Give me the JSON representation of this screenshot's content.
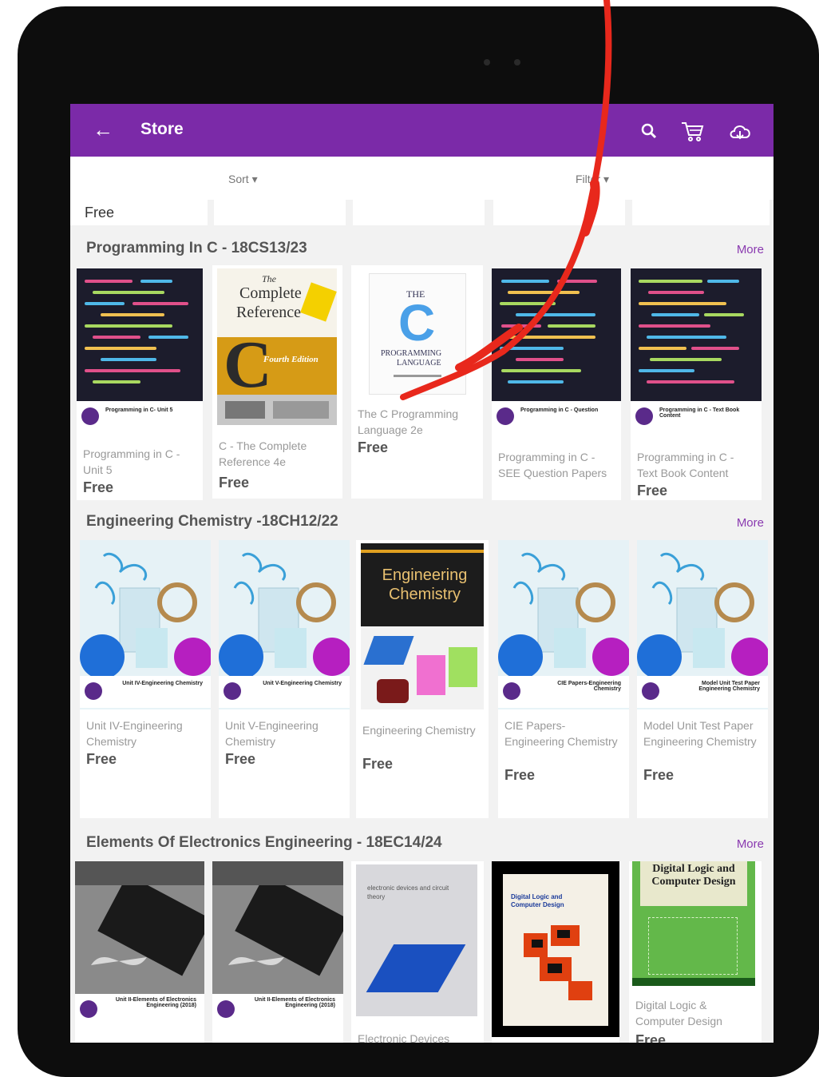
{
  "appbar": {
    "title": "Store"
  },
  "sortbar": {
    "sort_label": "Sort ▾",
    "filter_label": "Filter ▾"
  },
  "prev_row": {
    "price": "Free"
  },
  "sections": [
    {
      "title": "Programming In C - 18CS13/23",
      "more": "More",
      "cards": [
        {
          "title": "Programming in C - Unit 5",
          "price": "Free",
          "cover_type": "code"
        },
        {
          "title": "C - The Complete Reference 4e",
          "price": "Free",
          "cover_type": "c-ref"
        },
        {
          "title": "The C Programming Language 2e",
          "price": "Free",
          "cover_type": "kr"
        },
        {
          "title": "Programming in C - SEE Question Papers",
          "price": "",
          "cover_type": "code"
        },
        {
          "title": "Programming in C - Text Book Content",
          "price": "Free",
          "cover_type": "code"
        }
      ]
    },
    {
      "title": "Engineering Chemistry -18CH12/22",
      "more": "More",
      "cards": [
        {
          "title": "Unit IV-Engineering Chemistry",
          "price": "Free",
          "cover_type": "chem"
        },
        {
          "title": "Unit V-Engineering Chemistry",
          "price": "Free",
          "cover_type": "chem"
        },
        {
          "title": "Engineering Chemistry",
          "price": "Free",
          "cover_type": "chem-book"
        },
        {
          "title": "CIE Papers-Engineering Chemistry",
          "price": "Free",
          "cover_type": "chem"
        },
        {
          "title": "Model Unit Test Paper Engineering Chemistry",
          "price": "Free",
          "cover_type": "chem"
        }
      ]
    },
    {
      "title": "Elements Of Electronics Engineering - 18EC14/24",
      "more": "More",
      "cards": [
        {
          "title": "",
          "price": "",
          "cover_type": "chip"
        },
        {
          "title": "",
          "price": "",
          "cover_type": "chip"
        },
        {
          "title": "Electronic Devices",
          "price": "",
          "cover_type": "devices"
        },
        {
          "title": "",
          "price": "",
          "cover_type": "dl-black"
        },
        {
          "title": "Digital Logic & Computer Design",
          "price": "Free",
          "cover_type": "dl-green"
        }
      ]
    }
  ],
  "book_covers": {
    "c_ref_line1": "The",
    "c_ref_line2": "Complete",
    "c_ref_line3": "Reference",
    "c_ref_letter": "C",
    "c_ref_edition": "Fourth Edition",
    "kr_the": "THE",
    "kr_letter": "C",
    "kr_prog": "PROGRAMMING",
    "kr_lang": "LANGUAGE",
    "chem_book_title": "Engineering Chemistry",
    "dl_black_title": "Digital Logic and Computer Design",
    "dl_green_title": "Digital Logic and Computer Design",
    "devices_title": "electronic devices and circuit theory"
  },
  "strip_labels": {
    "code1": "Programming in C- Unit 5",
    "code2": "Programming in C - Question",
    "code3": "Programming in C - Text Book Content",
    "chem1": "Unit IV-Engineering Chemistry",
    "chem2": "Unit V-Engineering Chemistry",
    "chem3": "CIE Papers-Engineering Chemistry",
    "chem4": "Model Unit Test Paper Engineering Chemistry",
    "chip1": "Unit II-Elements of Electronics Engineering (2018)",
    "chip2": "Unit II-Elements of Electronics Engineering (2018)"
  },
  "colors": {
    "appbar": "#7b2aa8",
    "annotation": "#e8281c"
  }
}
